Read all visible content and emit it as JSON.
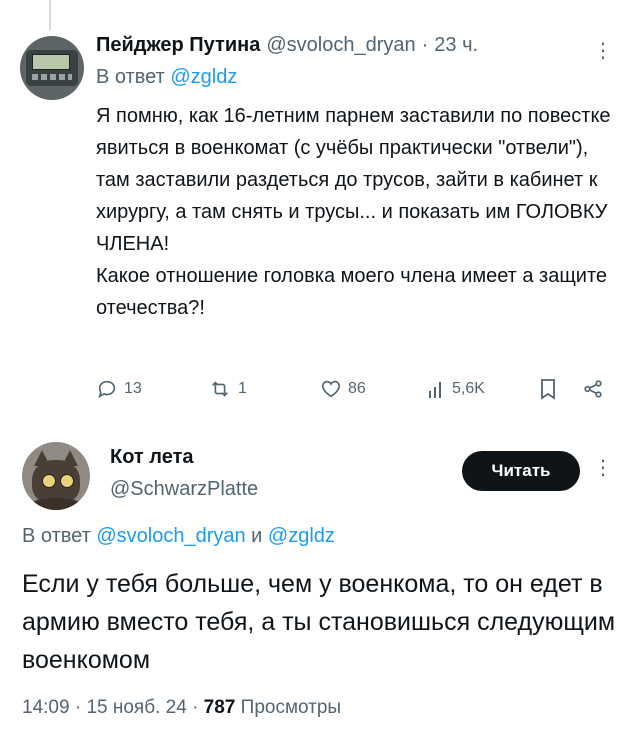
{
  "reply_tweet": {
    "author_name": "Пейджер Путина",
    "handle": "@svoloch_dryan",
    "separator": "·",
    "time": "23 ч.",
    "replying_prefix": "В ответ",
    "replying_to": "@zgldz",
    "text_paragraphs": [
      "Я помню, как 16-летним парнем заставили по повестке явиться в военкомат (с учёбы практически \"отвели\"), там заставили раздеться до трусов, зайти в кабинет к хирургу, а там снять и трусы... и показать им ГОЛОВКУ ЧЛЕНА!",
      "Какое отношение головка моего члена имеет а защите отечества?!"
    ],
    "actions": {
      "replies": "13",
      "reposts": "1",
      "likes": "86",
      "views": "5,6K"
    },
    "more_icon": "more-dots-icon"
  },
  "main_tweet": {
    "author_name": "Кот лета",
    "handle": "@SchwarzPlatte",
    "follow_label": "Читать",
    "replying_prefix": "В ответ",
    "replying_to_1": "@svoloch_dryan",
    "replying_and": "и",
    "replying_to_2": "@zgldz",
    "text": "Если у тебя больше, чем у военкома, то он едет в армию вместо тебя, а ты становишься следующим военкомом",
    "time": "14:09",
    "separator": "·",
    "date": "15 нояб. 24",
    "views_count": "787",
    "views_label": "Просмотры"
  },
  "colors": {
    "text": "#0f1419",
    "secondary": "#536471",
    "link": "#1d9bf0",
    "button_bg": "#0f1419"
  }
}
